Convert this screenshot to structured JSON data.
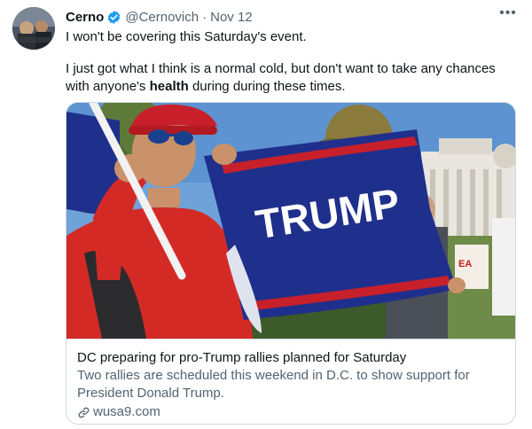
{
  "tweet": {
    "author_name": "Cerno",
    "handle": "@Cernovich",
    "separator": "·",
    "date": "Nov 12",
    "more_label": "•••",
    "line1": "I won't be covering this Saturday's event.",
    "line2_before": "I just got what I think is a normal cold, but don't want to take any chances with anyone's ",
    "line2_bold": "health",
    "line2_after": " during during these times."
  },
  "card": {
    "image_flag_text": "TRUMP",
    "title": "DC preparing for pro-Trump rallies planned for Saturday",
    "description": "Two rallies are scheduled this weekend in D.C. to show support for President Donald Trump.",
    "domain": "wusa9.com"
  },
  "colors": {
    "verified": "#1d9bf0",
    "flag_blue": "#1f2f8c",
    "hat_red": "#c8202a",
    "secondary_text": "#536471"
  },
  "icons": [
    "verified-badge-icon",
    "more-options-icon",
    "link-icon"
  ]
}
